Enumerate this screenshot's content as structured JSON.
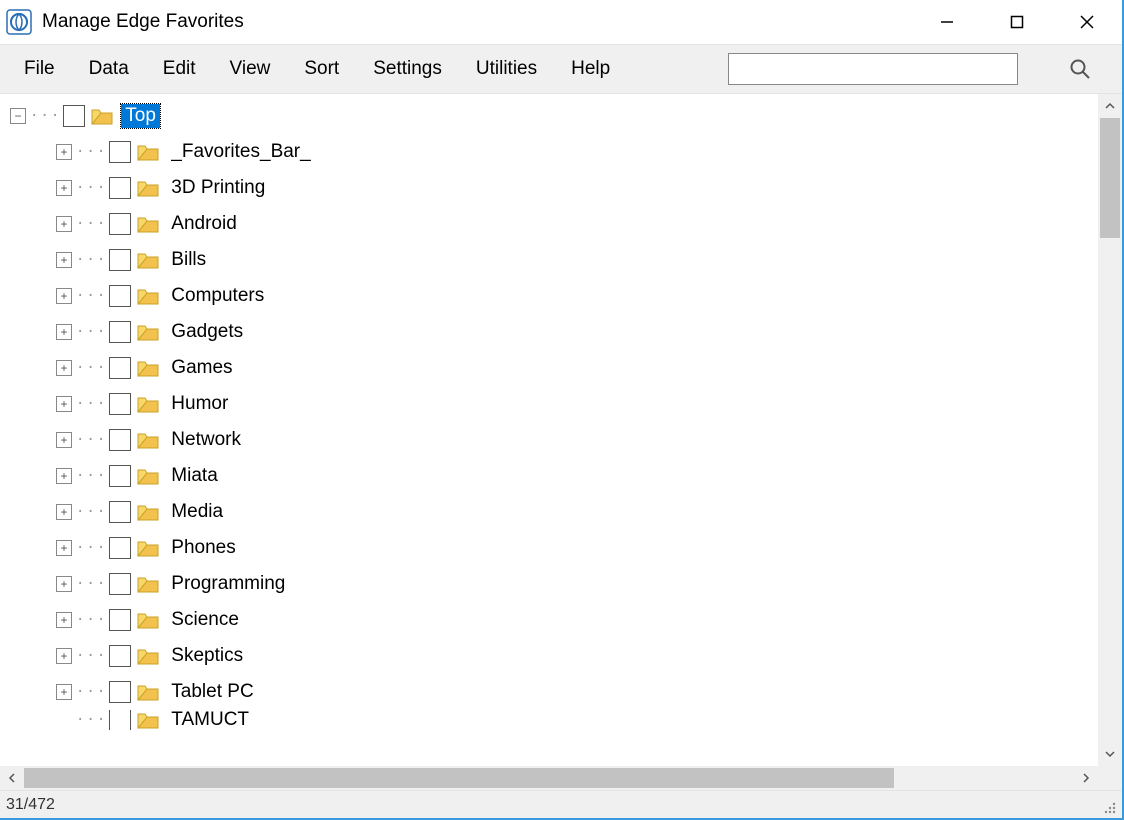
{
  "window": {
    "title": "Manage Edge Favorites"
  },
  "menu": {
    "items": [
      "File",
      "Data",
      "Edit",
      "View",
      "Sort",
      "Settings",
      "Utilities",
      "Help"
    ]
  },
  "search": {
    "value": ""
  },
  "tree": {
    "root": {
      "label": "Top",
      "expanded": true,
      "selected": true
    },
    "children": [
      {
        "label": "_Favorites_Bar_"
      },
      {
        "label": "3D Printing"
      },
      {
        "label": "Android"
      },
      {
        "label": "Bills"
      },
      {
        "label": "Computers"
      },
      {
        "label": "Gadgets"
      },
      {
        "label": "Games"
      },
      {
        "label": "Humor"
      },
      {
        "label": "Network"
      },
      {
        "label": "Miata"
      },
      {
        "label": "Media"
      },
      {
        "label": "Phones"
      },
      {
        "label": "Programming"
      },
      {
        "label": "Science"
      },
      {
        "label": "Skeptics"
      },
      {
        "label": "Tablet PC"
      },
      {
        "label": "TAMUCT"
      }
    ]
  },
  "status": {
    "text": "31/472"
  },
  "glyphs": {
    "minus": "−",
    "plus": "+"
  }
}
